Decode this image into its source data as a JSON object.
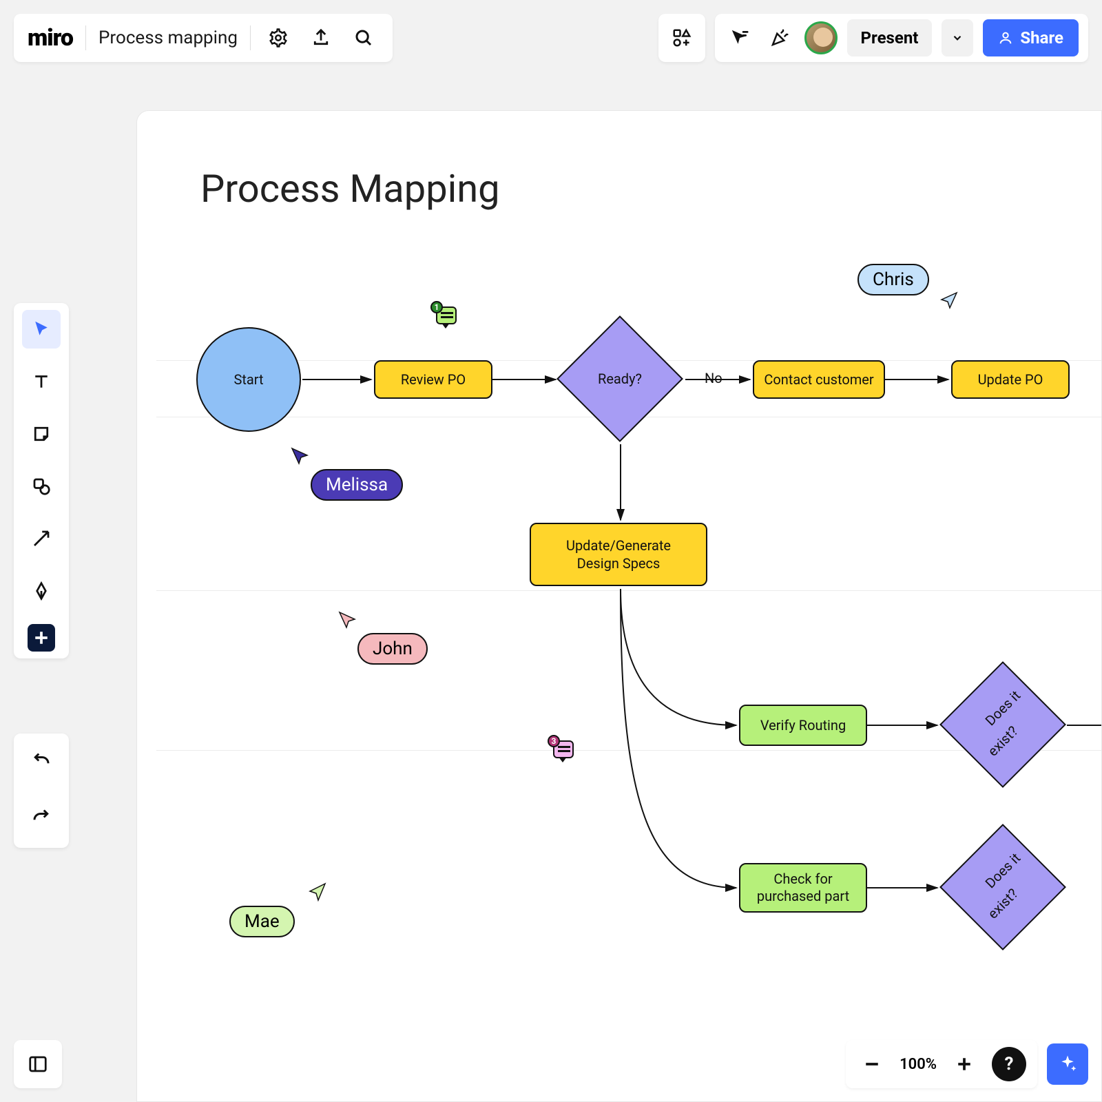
{
  "header": {
    "brand": "miro",
    "board_name": "Process mapping",
    "present_label": "Present",
    "share_label": "Share"
  },
  "zoom": {
    "level": "100%"
  },
  "canvas": {
    "title": "Process Mapping",
    "nodes": {
      "start": "Start",
      "review_po": "Review PO",
      "ready": "Ready?",
      "contact_customer": "Contact customer",
      "update_po": "Update PO",
      "update_specs_l1": "Update/Generate",
      "update_specs_l2": "Design Specs",
      "verify_routing": "Verify Routing",
      "exist1_l1": "Does it",
      "exist1_l2": "exist?",
      "check_part_l1": "Check for",
      "check_part_l2": "purchased part",
      "exist2_l1": "Does it",
      "exist2_l2": "exist?"
    },
    "edge_labels": {
      "ready_no": "No"
    },
    "collaborators": {
      "chris": "Chris",
      "melissa": "Melissa",
      "john": "John",
      "mae": "Mae"
    },
    "comments": {
      "c1": "1",
      "c2": "3"
    }
  }
}
